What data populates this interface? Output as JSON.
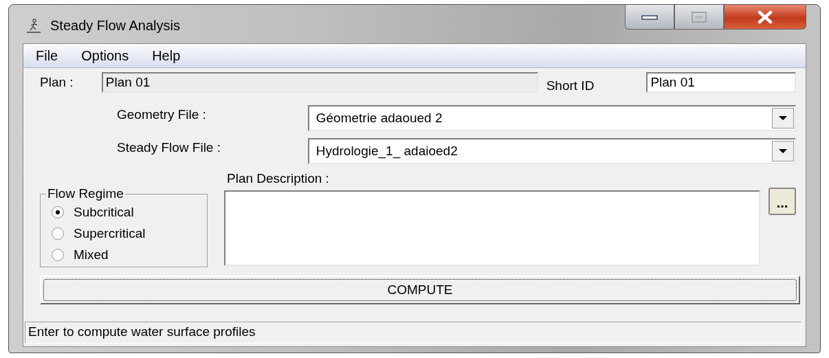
{
  "window": {
    "title": "Steady Flow Analysis"
  },
  "menu": [
    "File",
    "Options",
    "Help"
  ],
  "plan": {
    "label": "Plan :",
    "value": "Plan 01",
    "disabled": true
  },
  "short_id": {
    "label": "Short ID",
    "value": "Plan 01"
  },
  "file_selectors": [
    {
      "label": "Geometry File :",
      "value": "Géometrie adaoued 2"
    },
    {
      "label": "Steady Flow File :",
      "value": "Hydrologie_1_ adaioed2"
    }
  ],
  "flow_regime": {
    "title": "Flow Regime",
    "options": [
      {
        "label": "Subcritical",
        "selected": true
      },
      {
        "label": "Supercritical",
        "selected": false
      },
      {
        "label": "Mixed",
        "selected": false
      }
    ]
  },
  "plan_description": {
    "label": "Plan Description :",
    "browse_button": "..."
  },
  "compute_button": {
    "label": "COMPUTE",
    "focused": true
  },
  "status_bar": "Enter to compute water surface profiles"
}
